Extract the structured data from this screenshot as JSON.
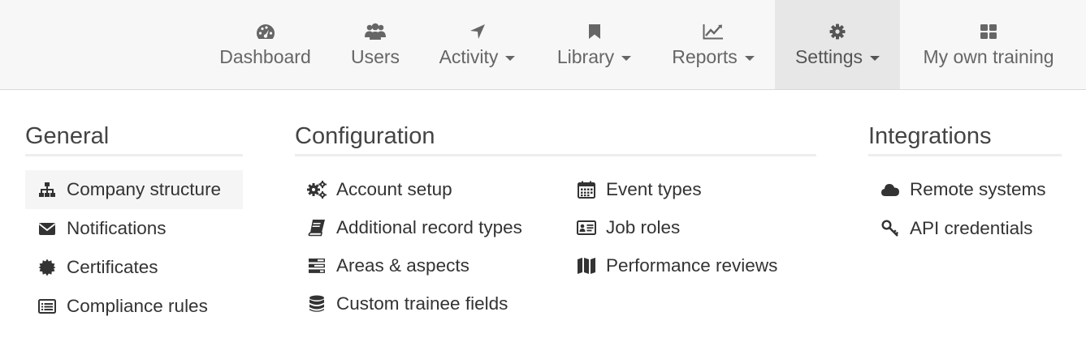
{
  "nav": {
    "items": [
      {
        "label": "Dashboard",
        "icon": "dashboard-icon",
        "caret": false
      },
      {
        "label": "Users",
        "icon": "users-icon",
        "caret": false
      },
      {
        "label": "Activity",
        "icon": "location-arrow-icon",
        "caret": true
      },
      {
        "label": "Library",
        "icon": "bookmark-icon",
        "caret": true
      },
      {
        "label": "Reports",
        "icon": "line-chart-icon",
        "caret": true
      },
      {
        "label": "Settings",
        "icon": "gear-icon",
        "caret": true,
        "active": true
      },
      {
        "label": "My own training",
        "icon": "grid-icon",
        "caret": false
      }
    ]
  },
  "settings_menu": {
    "general": {
      "title": "General",
      "items": [
        {
          "label": "Company structure",
          "icon": "sitemap-icon"
        },
        {
          "label": "Notifications",
          "icon": "envelope-icon"
        },
        {
          "label": "Certificates",
          "icon": "certificate-icon"
        },
        {
          "label": "Compliance rules",
          "icon": "list-alt-icon"
        }
      ]
    },
    "configuration": {
      "title": "Configuration",
      "col1": [
        {
          "label": "Account setup",
          "icon": "cogs-icon"
        },
        {
          "label": "Additional record types",
          "icon": "book-icon"
        },
        {
          "label": "Areas & aspects",
          "icon": "tasks-icon"
        },
        {
          "label": "Custom trainee fields",
          "icon": "database-icon"
        }
      ],
      "col2": [
        {
          "label": "Event types",
          "icon": "calendar-icon"
        },
        {
          "label": "Job roles",
          "icon": "id-card-icon"
        },
        {
          "label": "Performance reviews",
          "icon": "map-icon"
        }
      ]
    },
    "integrations": {
      "title": "Integrations",
      "items": [
        {
          "label": "Remote systems",
          "icon": "cloud-icon"
        },
        {
          "label": "API credentials",
          "icon": "key-icon"
        }
      ]
    }
  },
  "colors": {
    "navbar_bg": "#f7f7f7",
    "active_tab_bg": "#e7e7e7",
    "nav_text": "#666666",
    "menu_text": "#333333",
    "highlight_bg": "#f5f5f5"
  }
}
